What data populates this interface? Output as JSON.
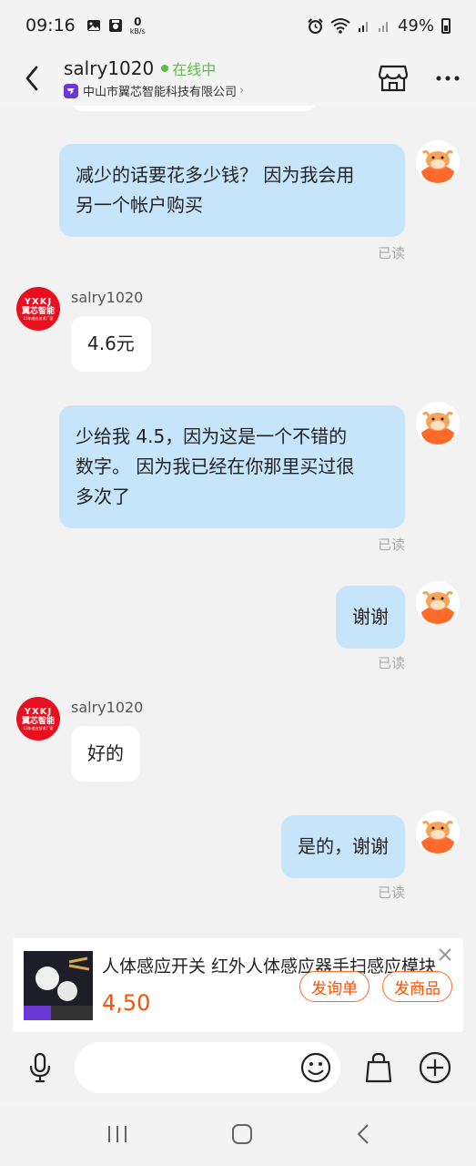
{
  "status_bar": {
    "time": "09:16",
    "net_speed_value": "0",
    "net_speed_unit": "kB/s",
    "battery": "49%"
  },
  "header": {
    "contact_name": "salry1020",
    "online_status": "在线中",
    "company": "中山市翼芯智能科技有限公司"
  },
  "shop_avatar": {
    "line1": "YXKJ",
    "line2": "翼芯智能",
    "line3": "13年感应技术厂家"
  },
  "messages": [
    {
      "direction": "out",
      "text_lines": [
        "减少的话要花多少钱？ 因为我会用",
        "另一个帐户购买"
      ],
      "status": "已读"
    },
    {
      "direction": "in",
      "sender": "salry1020",
      "text": "4.6元"
    },
    {
      "direction": "out",
      "text_lines": [
        "少给我 4.5，因为这是一个不错的",
        "数字。 因为我已经在你那里买过很",
        "多次了"
      ],
      "status": "已读"
    },
    {
      "direction": "out",
      "text_lines": [
        "谢谢"
      ],
      "status": "已读"
    },
    {
      "direction": "in",
      "sender": "salry1020",
      "text": "好的"
    },
    {
      "direction": "out",
      "text_lines": [
        "是的，谢谢"
      ],
      "status": "已读"
    }
  ],
  "product_card": {
    "title": "人体感应开关 红外人体感应器手扫感应模块",
    "price": "4,50",
    "inquiry_button": "发询单",
    "send_product_button": "发商品"
  },
  "input_bar": {
    "placeholder": ""
  },
  "colors": {
    "accent": "#ff5000",
    "outgoing_bubble": "#c6e5fb",
    "online": "#58c13f",
    "shop_avatar_bg": "#e8101e"
  }
}
